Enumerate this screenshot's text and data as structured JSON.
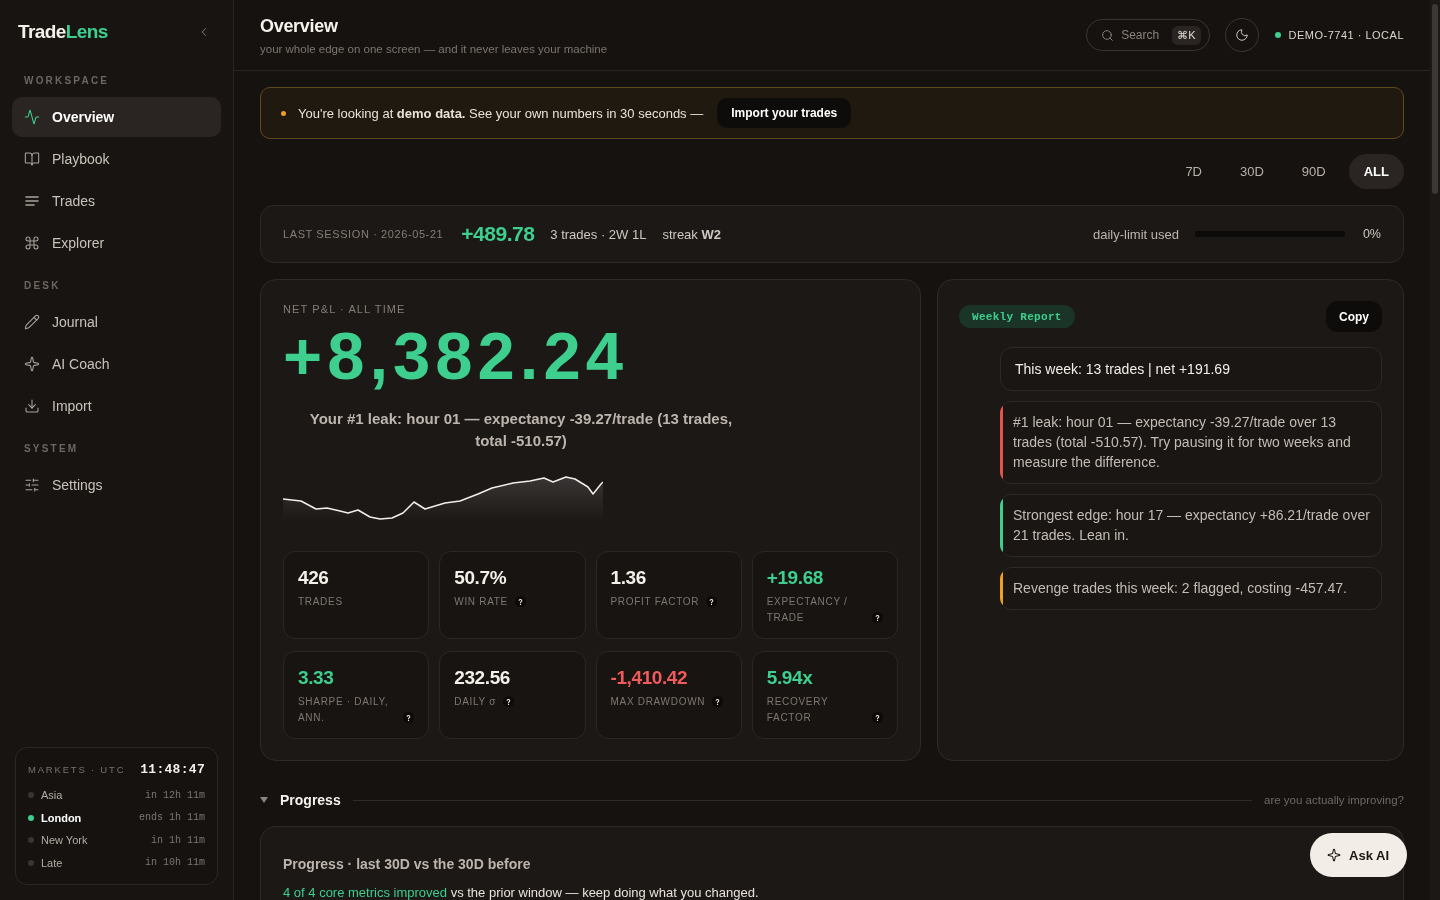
{
  "sidebar": {
    "brand": {
      "name": "Trade",
      "accent": "Lens"
    },
    "sections": [
      {
        "title": "WORKSPACE",
        "items": [
          {
            "label": "Overview",
            "selected": true
          },
          {
            "label": "Playbook",
            "selected": false
          },
          {
            "label": "Trades",
            "selected": false
          },
          {
            "label": "Explorer",
            "selected": false
          }
        ]
      },
      {
        "title": "DESK",
        "items": [
          {
            "label": "Journal",
            "selected": false
          },
          {
            "label": "AI Coach",
            "selected": false
          },
          {
            "label": "Import",
            "selected": false
          }
        ]
      },
      {
        "title": "SYSTEM",
        "items": [
          {
            "label": "Settings",
            "selected": false
          }
        ]
      }
    ],
    "markets": {
      "title": "MARKETS · UTC",
      "time": "11:48:47",
      "sessions": [
        {
          "name": "Asia",
          "status": "in 12h 11m",
          "open": false
        },
        {
          "name": "London",
          "status": "ends 1h 11m",
          "open": true
        },
        {
          "name": "New York",
          "status": "in 1h 11m",
          "open": false
        },
        {
          "name": "Late",
          "status": "in 10h 11m",
          "open": false
        }
      ]
    }
  },
  "header": {
    "title": "Overview",
    "subtitle": "your whole edge on one screen — and it never leaves your machine",
    "search": {
      "label": "Search",
      "shortcut": "⌘K"
    },
    "workspace": "DEMO-7741 · LOCAL"
  },
  "banner": {
    "text": "You're looking at **demo data.** See your own numbers in 30 seconds —",
    "button": "Import your trades"
  },
  "range_tabs": [
    {
      "label": "7D",
      "selected": false
    },
    {
      "label": "30D",
      "selected": false
    },
    {
      "label": "90D",
      "selected": false
    },
    {
      "label": "ALL",
      "selected": true
    }
  ],
  "last_session": {
    "label": "LAST SESSION · 2026-05-21",
    "pnl": "+489.78",
    "trades": "3 trades · 2W 1L",
    "streak": "streak **W2**",
    "limit_label": "daily-limit used",
    "level": 0,
    "reading": "0%"
  },
  "net_pnl": {
    "label": "NET P&L · ALL TIME",
    "value": "+8,382.24",
    "leak": "Your #1 leak: **hour 01** — expectancy -39.27/trade (13 trades, total -510.57)",
    "metrics": [
      {
        "value": "426",
        "label": "TRADES",
        "color": "#f3efe9",
        "help": false
      },
      {
        "value": "50.7%",
        "label": "WIN RATE",
        "color": "#f3efe9",
        "help": true
      },
      {
        "value": "1.36",
        "label": "PROFIT FACTOR",
        "color": "#f3efe9",
        "help": true
      },
      {
        "value": "+19.68",
        "label": "EXPECTANCY / TRADE",
        "color": "#3ecf8e",
        "help": true
      },
      {
        "value": "3.33",
        "label": "SHARPE · DAILY, ANN.",
        "color": "#3ecf8e",
        "help": true
      },
      {
        "value": "232.56",
        "label": "DAILY σ",
        "color": "#f3efe9",
        "help": true
      },
      {
        "value": "-1,410.42",
        "label": "MAX DRAWDOWN",
        "color": "#ef5b5b",
        "help": true
      },
      {
        "value": "5.94x",
        "label": "RECOVERY FACTOR",
        "color": "#3ecf8e",
        "help": true
      }
    ]
  },
  "weekly_report": {
    "tag": "Weekly Report",
    "button": "Copy",
    "summary": "This week: 13 trades | net +191.69",
    "insights": [
      {
        "text": "#1 leak: hour 01 — expectancy -39.27/trade over 13 trades (total -510.57). Try pausing it for two weeks and measure the difference.",
        "color": "#e5534b"
      },
      {
        "text": "Strongest edge: hour 17 — expectancy +86.21/trade over 21 trades. Lean in.",
        "color": "#3ecf8e"
      },
      {
        "text": "Revenge trades this week: 2 flagged, costing -457.47.",
        "color": "#f0a020"
      }
    ]
  },
  "progress": {
    "title": "Progress",
    "expanded": true,
    "hint": "are you actually improving?",
    "card_title": "Progress · last 30D vs the 30D before",
    "improved": "4 of 4 core metrics improved",
    "summary": "vs the prior window — keep doing what you changed."
  },
  "ask_ai": "Ask AI"
}
